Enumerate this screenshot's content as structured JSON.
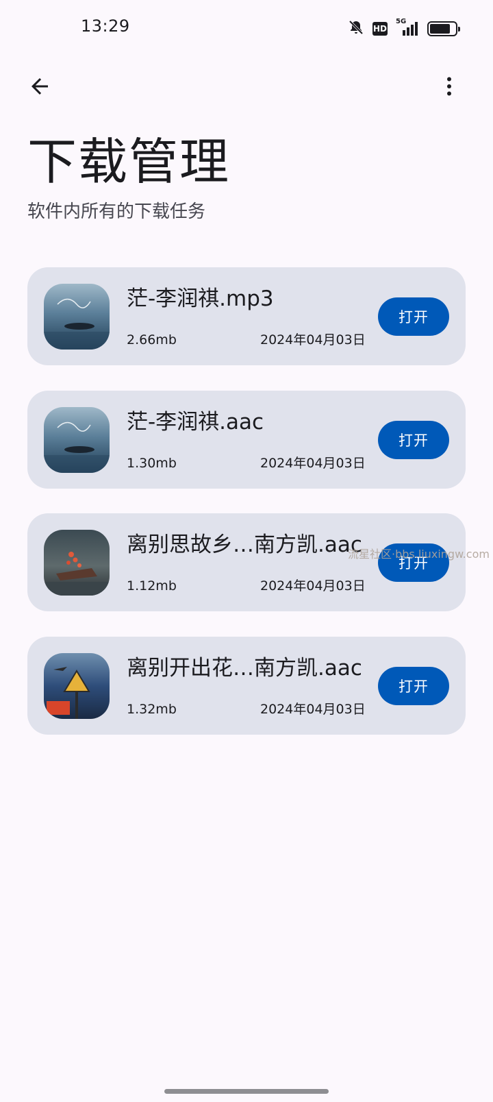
{
  "status_bar": {
    "time": "13:29",
    "network_label": "5G",
    "hd_label": "HD",
    "battery_level": 0.8
  },
  "header": {
    "title": "下载管理",
    "subtitle": "软件内所有的下载任务"
  },
  "downloads": [
    {
      "name": "茫-李润祺.mp3",
      "size": "2.66mb",
      "date": "2024年04月03日",
      "action": "打开"
    },
    {
      "name": "茫-李润祺.aac",
      "size": "1.30mb",
      "date": "2024年04月03日",
      "action": "打开"
    },
    {
      "name": "离别思故乡…南方凯.aac",
      "size": "1.12mb",
      "date": "2024年04月03日",
      "action": "打开"
    },
    {
      "name": "离别开出花…南方凯.aac",
      "size": "1.32mb",
      "date": "2024年04月03日",
      "action": "打开"
    }
  ],
  "watermark": "流星社区·bbs.liuxingw.com",
  "icons": {
    "back": "arrow-left-icon",
    "more": "more-vertical-icon",
    "mute": "bell-off-icon",
    "signal": "signal-icon",
    "battery": "battery-icon"
  }
}
